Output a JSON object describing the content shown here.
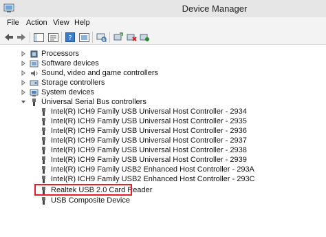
{
  "window": {
    "title": "Device Manager"
  },
  "menu": {
    "items": [
      "File",
      "Action",
      "View",
      "Help"
    ]
  },
  "toolbar": {
    "buttons": [
      "back-icon",
      "forward-icon",
      "show-hide-console-tree-icon",
      "properties-icon",
      "help-icon",
      "update-driver-icon",
      "scan-hardware-icon",
      "uninstall-icon",
      "disable-icon"
    ]
  },
  "tree": {
    "categories": {
      "processors": "Processors",
      "software": "Software devices",
      "sound": "Sound, video and game controllers",
      "storage": "Storage controllers",
      "system": "System devices",
      "usb": "Universal Serial Bus controllers"
    },
    "usb_devices": [
      "Intel(R) ICH9 Family USB Universal Host Controller - 2934",
      "Intel(R) ICH9 Family USB Universal Host Controller - 2935",
      "Intel(R) ICH9 Family USB Universal Host Controller - 2936",
      "Intel(R) ICH9 Family USB Universal Host Controller - 2937",
      "Intel(R) ICH9 Family USB Universal Host Controller - 2938",
      "Intel(R) ICH9 Family USB Universal Host Controller - 2939",
      "Intel(R) ICH9 Family USB2 Enhanced Host Controller - 293A",
      "Intel(R) ICH9 Family USB2 Enhanced Host Controller - 293C",
      "Realtek USB 2.0 Card Reader",
      "USB Composite Device"
    ]
  },
  "colors": {
    "highlight_border": "#e0212d",
    "titlebar": "#e6e6e6",
    "menubar": "#f3f3f3"
  }
}
